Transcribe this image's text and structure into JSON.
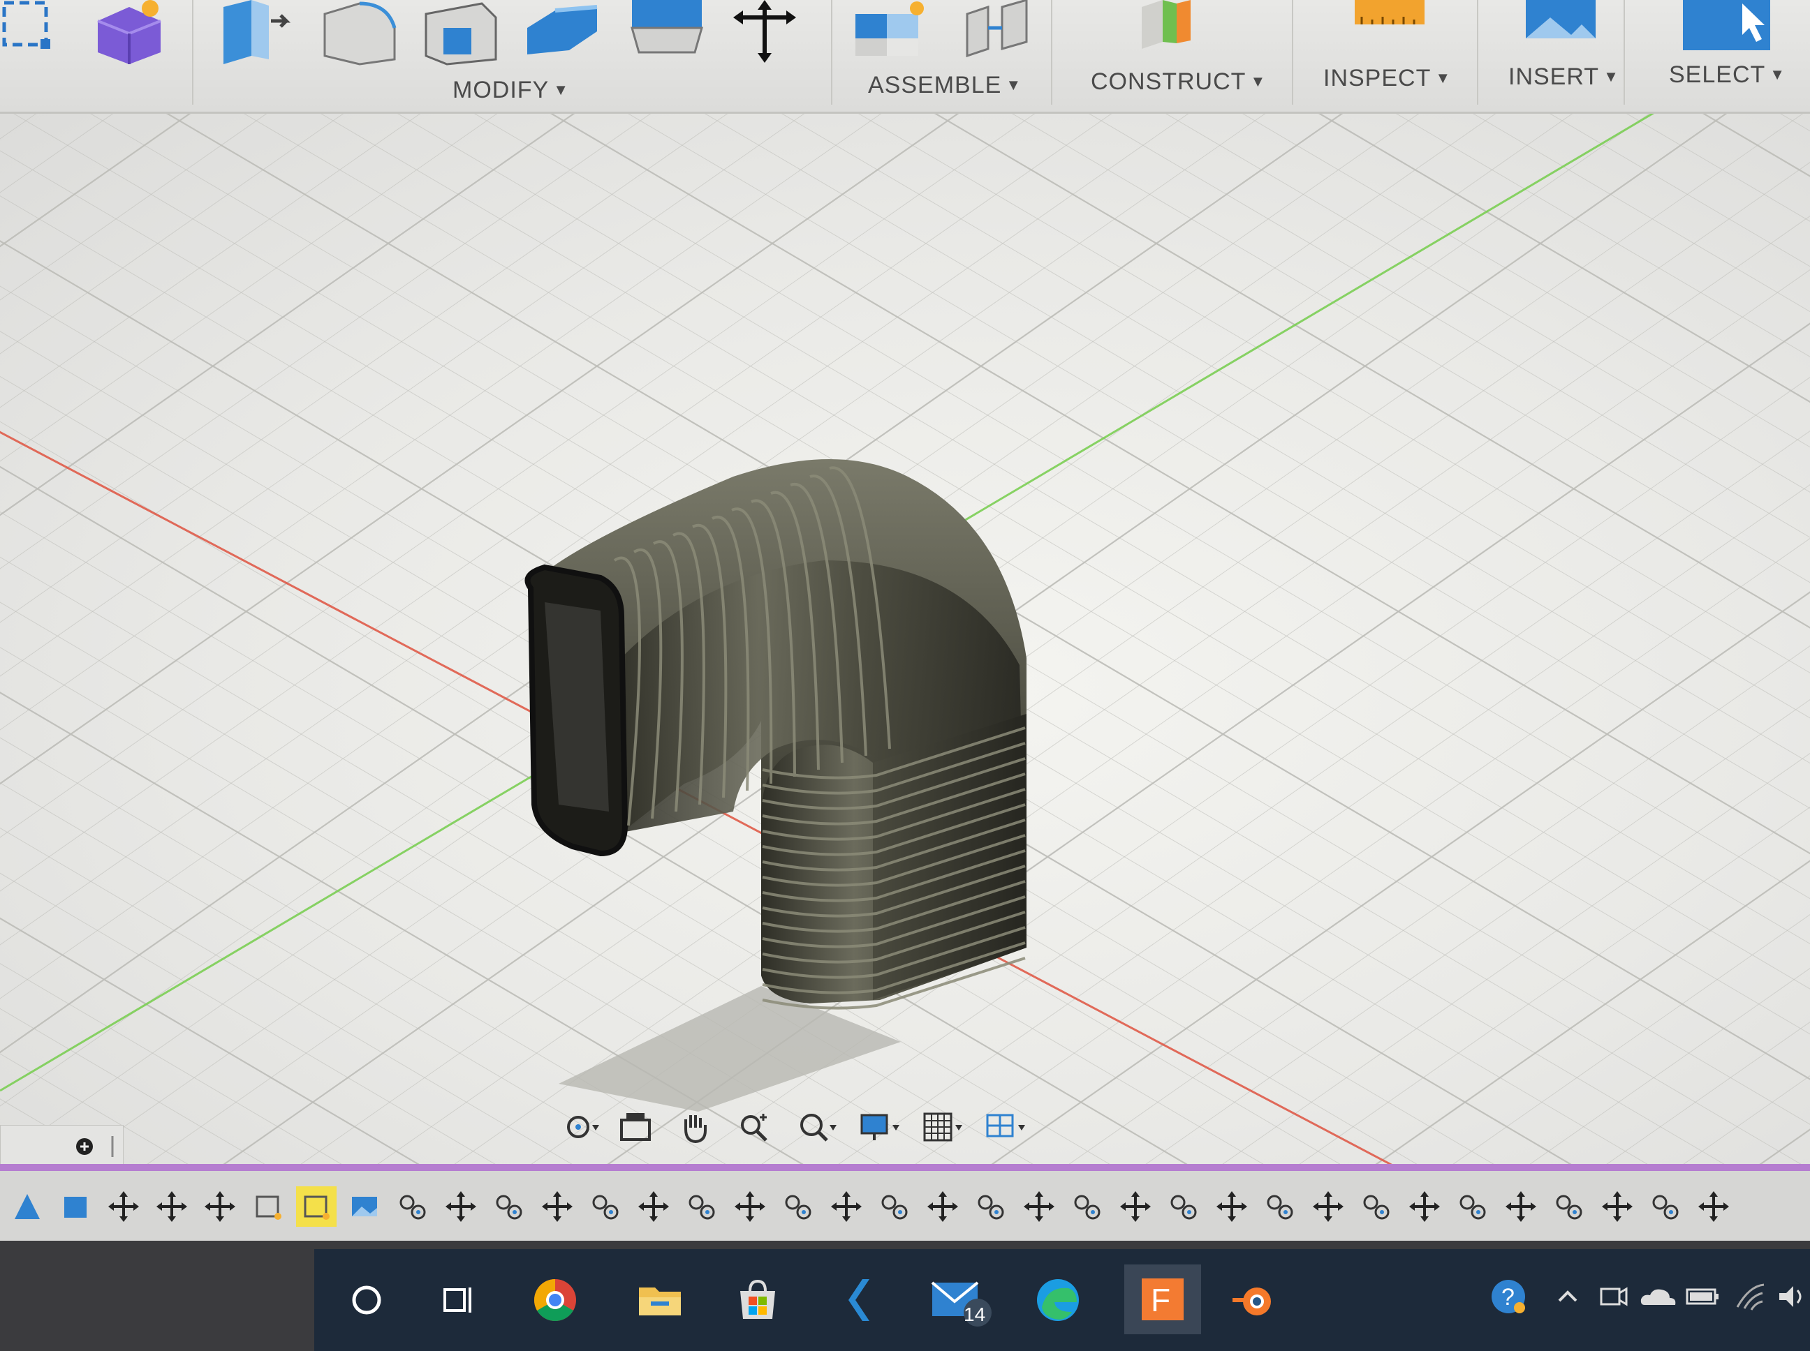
{
  "toolbar": {
    "groups": [
      {
        "label": "MODIFY",
        "caret": "▼"
      },
      {
        "label": "ASSEMBLE",
        "caret": "▼"
      },
      {
        "label": "CONSTRUCT",
        "caret": "▼"
      },
      {
        "label": "INSPECT",
        "caret": "▼"
      },
      {
        "label": "INSERT",
        "caret": "▼"
      },
      {
        "label": "SELECT",
        "caret": "▼"
      }
    ],
    "icons": [
      "sketch-dimension-icon",
      "purple-cube-icon",
      "press-pull-icon",
      "fillet-icon",
      "chamfer-icon",
      "shell-icon",
      "combine-icon",
      "move-copy-icon",
      "new-component-icon",
      "joint-icon",
      "offset-plane-icon",
      "measure-icon",
      "insert-image-icon",
      "select-cursor-icon"
    ]
  },
  "navigation_bar": {
    "tools": [
      "orbit-icon",
      "look-at-icon",
      "pan-hand-icon",
      "zoom-icon",
      "fit-zoom-icon",
      "display-settings-icon",
      "grid-settings-icon",
      "viewports-icon"
    ]
  },
  "timeline": {
    "item_count": 36
  },
  "taskbar": {
    "apps": [
      "cortana-search-icon",
      "task-view-icon",
      "chrome-icon",
      "file-explorer-icon",
      "microsoft-store-icon",
      "visual-studio-code-icon",
      "mail-icon",
      "edge-icon",
      "fusion-360-icon",
      "blender-icon"
    ],
    "mail_badge": "14",
    "tray": [
      "help-icon",
      "show-hidden-icons-chevron",
      "meet-now-icon",
      "onedrive-cloud-icon",
      "battery-icon",
      "wifi-icon",
      "volume-icon"
    ]
  },
  "colors": {
    "toolbar_background": "#e4e4e2",
    "viewport_background": "#ececea",
    "timeline_accent": "#b57dd0",
    "taskbar_background": "#1d2a3a",
    "model_color": "#4a4a3e",
    "x_axis": "#e05c4a",
    "y_axis": "#7ccf55"
  }
}
